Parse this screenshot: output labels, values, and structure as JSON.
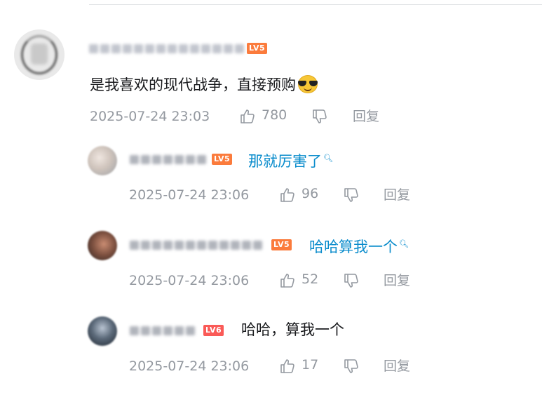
{
  "main_comment": {
    "level": "LV5",
    "content": "是我喜欢的现代战争，直接预购",
    "emoji": "sunglasses-emoji",
    "time": "2025-07-24 23:03",
    "likes": "780",
    "reply_label": "回复"
  },
  "replies": [
    {
      "level": "LV5",
      "content": "那就厉害了",
      "content_is_search_link": true,
      "time": "2025-07-24 23:06",
      "likes": "96",
      "reply_label": "回复"
    },
    {
      "level": "LV5",
      "content": "哈哈算我一个",
      "content_is_search_link": true,
      "time": "2025-07-24 23:06",
      "likes": "52",
      "reply_label": "回复"
    },
    {
      "level": "LV6",
      "content": "哈哈，算我一个",
      "content_is_search_link": false,
      "time": "2025-07-24 23:06",
      "likes": "17",
      "reply_label": "回复"
    }
  ],
  "colors": {
    "link": "#0a8ccc",
    "meta": "#9499a0",
    "lv5": "#fb7b3c",
    "lv6": "#fa5a57",
    "text": "#18191c"
  }
}
